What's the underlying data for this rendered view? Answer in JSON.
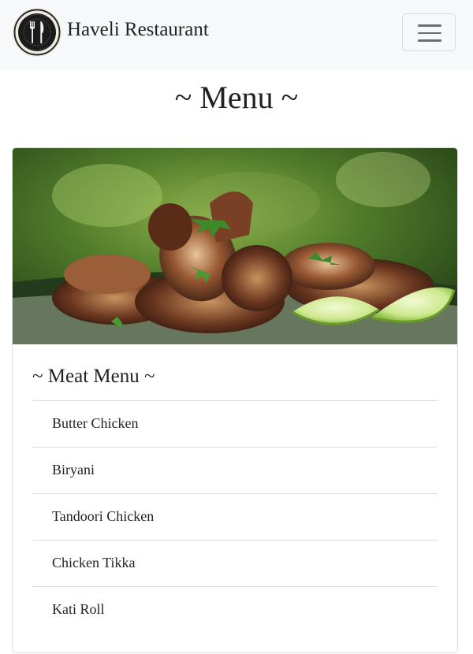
{
  "navbar": {
    "brand": "Haveli Restaurant",
    "logo_icon": "fork-knife-plate-icon",
    "toggler_icon": "hamburger-menu-icon"
  },
  "page": {
    "title": "~ Menu ~"
  },
  "card": {
    "image": "grilled-chicken-photo",
    "title": "~ Meat Menu ~",
    "items": [
      {
        "label": "Butter Chicken"
      },
      {
        "label": "Biryani"
      },
      {
        "label": "Tandoori Chicken"
      },
      {
        "label": "Chicken Tikka"
      },
      {
        "label": "Kati Roll"
      }
    ]
  },
  "colors": {
    "navbar_bg": "#f7f8fa",
    "border": "#dcdcdc",
    "text": "#222222",
    "toggler_bar": "#6b6e71"
  }
}
